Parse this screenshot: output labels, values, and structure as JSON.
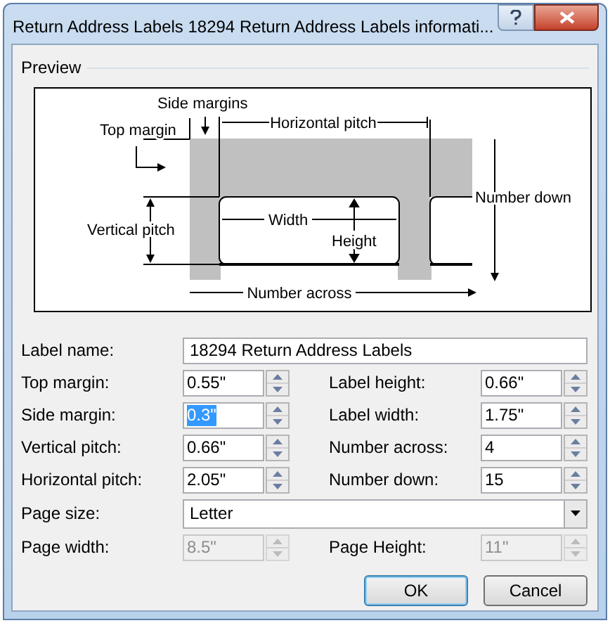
{
  "window": {
    "title": "Return Address Labels 18294 Return Address Labels informati..."
  },
  "preview": {
    "title": "Preview",
    "labels": [
      {
        "text": "Side margins"
      },
      {
        "text": "Horizontal pitch"
      },
      {
        "text": "Top margin"
      },
      {
        "text": "Number down"
      },
      {
        "text": "Width"
      },
      {
        "text": "Vertical pitch"
      },
      {
        "text": "Height"
      },
      {
        "text": "Number across"
      }
    ]
  },
  "rows": [
    [
      {
        "label": "Label name:",
        "kind": "text",
        "value": "18294 Return Address Labels",
        "selected": false,
        "disabled": false
      }
    ],
    [
      {
        "label": "Top margin:",
        "kind": "spinner",
        "value": "0.55\"",
        "selected": false,
        "disabled": false
      },
      {
        "label": "Label height:",
        "kind": "spinner",
        "value": "0.66\"",
        "selected": false,
        "disabled": false
      }
    ],
    [
      {
        "label": "Side margin:",
        "kind": "spinner",
        "value": "0.3\"",
        "selected": true,
        "disabled": false
      },
      {
        "label": "Label width:",
        "kind": "spinner",
        "value": "1.75\"",
        "selected": false,
        "disabled": false
      }
    ],
    [
      {
        "label": "Vertical pitch:",
        "kind": "spinner",
        "value": "0.66\"",
        "selected": false,
        "disabled": false
      },
      {
        "label": "Number across:",
        "kind": "spinner",
        "value": "4",
        "selected": false,
        "disabled": false
      }
    ],
    [
      {
        "label": "Horizontal pitch:",
        "kind": "spinner",
        "value": "2.05\"",
        "selected": false,
        "disabled": false
      },
      {
        "label": "Number down:",
        "kind": "spinner",
        "value": "15",
        "selected": false,
        "disabled": false
      }
    ],
    [
      {
        "label": "Page size:",
        "kind": "dropdown",
        "value": "Letter",
        "selected": false,
        "disabled": false
      }
    ],
    [
      {
        "label": "Page width:",
        "kind": "spinner",
        "value": "8.5\"",
        "selected": false,
        "disabled": true
      },
      {
        "label": "Page Height:",
        "kind": "spinner",
        "value": "11\"",
        "selected": false,
        "disabled": true
      }
    ]
  ],
  "buttons": [
    {
      "label": "OK",
      "default": true
    },
    {
      "label": "Cancel",
      "default": false
    }
  ]
}
